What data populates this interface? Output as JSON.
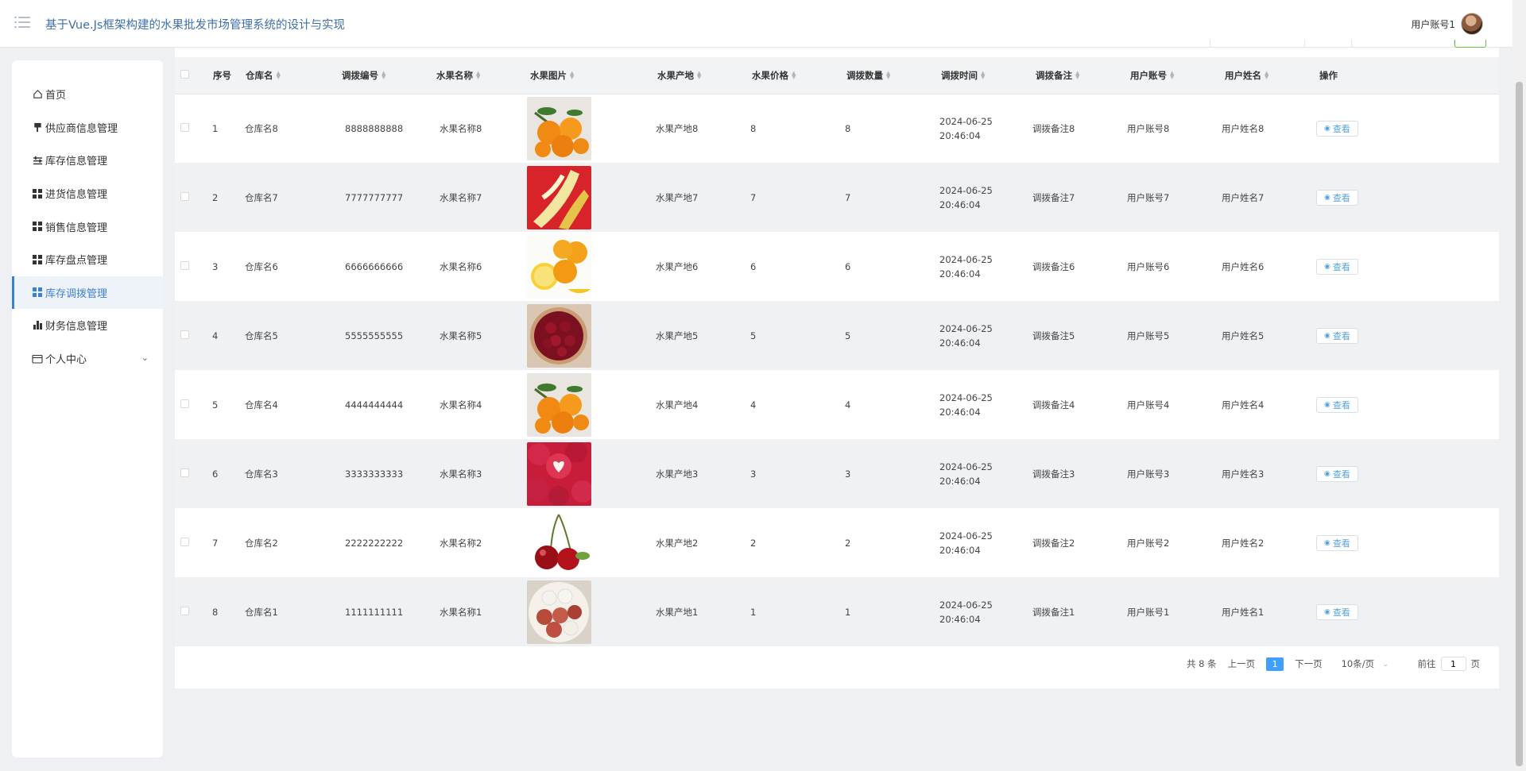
{
  "header": {
    "title": "基于Vue.Js框架构建的水果批发市场管理系统的设计与实现",
    "user": "用户账号1"
  },
  "sidebar": {
    "items": [
      {
        "label": "首页",
        "icon": "home-icon"
      },
      {
        "label": "供应商信息管理",
        "icon": "flag-icon"
      },
      {
        "label": "库存信息管理",
        "icon": "sliders-icon"
      },
      {
        "label": "进货信息管理",
        "icon": "grid-icon"
      },
      {
        "label": "销售信息管理",
        "icon": "grid-icon"
      },
      {
        "label": "库存盘点管理",
        "icon": "grid-icon"
      },
      {
        "label": "库存调拨管理",
        "icon": "grid-icon",
        "active": true
      },
      {
        "label": "财务信息管理",
        "icon": "bar-chart-icon"
      },
      {
        "label": "个人中心",
        "icon": "wallet-icon"
      }
    ]
  },
  "table": {
    "headers": [
      "序号",
      "仓库名",
      "调拨编号",
      "水果名称",
      "水果图片",
      "水果产地",
      "水果价格",
      "调拨数量",
      "调拨时间",
      "调拨备注",
      "用户账号",
      "用户姓名",
      "操作"
    ],
    "view_label": "查看",
    "rows": [
      {
        "no": "1",
        "warehouse": "仓库名8",
        "code": "8888888888",
        "name": "水果名称8",
        "image": "mandarins",
        "origin": "水果产地8",
        "price": "8",
        "qty": "8",
        "time": "2024-06-25 20:46:04",
        "note": "调拨备注8",
        "account": "用户账号8",
        "username": "用户姓名8"
      },
      {
        "no": "2",
        "warehouse": "仓库名7",
        "code": "7777777777",
        "name": "水果名称7",
        "image": "banana",
        "origin": "水果产地7",
        "price": "7",
        "qty": "7",
        "time": "2024-06-25 20:46:04",
        "note": "调拨备注7",
        "account": "用户账号7",
        "username": "用户姓名7"
      },
      {
        "no": "3",
        "warehouse": "仓库名6",
        "code": "6666666666",
        "name": "水果名称6",
        "image": "oranges",
        "origin": "水果产地6",
        "price": "6",
        "qty": "6",
        "time": "2024-06-25 20:46:04",
        "note": "调拨备注6",
        "account": "用户账号6",
        "username": "用户姓名6"
      },
      {
        "no": "4",
        "warehouse": "仓库名5",
        "code": "5555555555",
        "name": "水果名称5",
        "image": "cherries-bowl",
        "origin": "水果产地5",
        "price": "5",
        "qty": "5",
        "time": "2024-06-25 20:46:04",
        "note": "调拨备注5",
        "account": "用户账号5",
        "username": "用户姓名5"
      },
      {
        "no": "5",
        "warehouse": "仓库名4",
        "code": "4444444444",
        "name": "水果名称4",
        "image": "mandarins",
        "origin": "水果产地4",
        "price": "4",
        "qty": "4",
        "time": "2024-06-25 20:46:04",
        "note": "调拨备注4",
        "account": "用户账号4",
        "username": "用户姓名4"
      },
      {
        "no": "6",
        "warehouse": "仓库名3",
        "code": "3333333333",
        "name": "水果名称3",
        "image": "apples",
        "origin": "水果产地3",
        "price": "3",
        "qty": "3",
        "time": "2024-06-25 20:46:04",
        "note": "调拨备注3",
        "account": "用户账号3",
        "username": "用户姓名3"
      },
      {
        "no": "7",
        "warehouse": "仓库名2",
        "code": "2222222222",
        "name": "水果名称2",
        "image": "cherries",
        "origin": "水果产地2",
        "price": "2",
        "qty": "2",
        "time": "2024-06-25 20:46:04",
        "note": "调拨备注2",
        "account": "用户账号2",
        "username": "用户姓名2"
      },
      {
        "no": "8",
        "warehouse": "仓库名1",
        "code": "1111111111",
        "name": "水果名称1",
        "image": "lychees",
        "origin": "水果产地1",
        "price": "1",
        "qty": "1",
        "time": "2024-06-25 20:46:04",
        "note": "调拨备注1",
        "account": "用户账号1",
        "username": "用户姓名1"
      }
    ]
  },
  "pagination": {
    "total": "共 8 条",
    "prev": "上一页",
    "current": "1",
    "next": "下一页",
    "page_size": "10条/页",
    "goto_label": "前往",
    "goto_value": "1",
    "page_unit": "页"
  },
  "colors": {
    "accent": "#409eff",
    "title": "#3f6fa6",
    "active_nav": "#3e7fd6"
  }
}
